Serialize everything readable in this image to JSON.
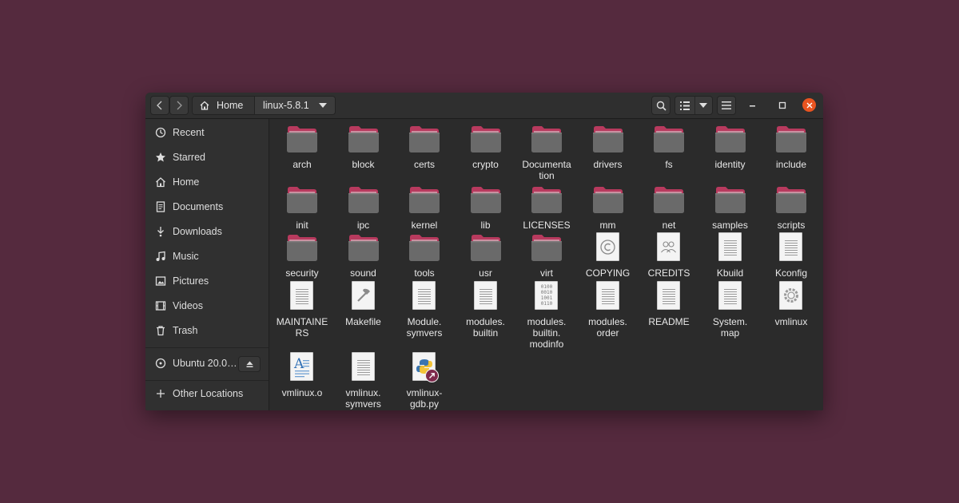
{
  "header": {
    "crumbs": [
      {
        "label": "Home",
        "icon": "home-icon"
      },
      {
        "label": "linux-5.8.1",
        "icon": "chevron-down-icon"
      }
    ]
  },
  "window_controls": [
    "minimize",
    "maximize",
    "close"
  ],
  "sidebar": {
    "items": [
      {
        "label": "Recent",
        "icon": "clock-icon"
      },
      {
        "label": "Starred",
        "icon": "star-icon"
      },
      {
        "label": "Home",
        "icon": "home-icon"
      },
      {
        "label": "Documents",
        "icon": "document-icon"
      },
      {
        "label": "Downloads",
        "icon": "download-icon"
      },
      {
        "label": "Music",
        "icon": "music-icon"
      },
      {
        "label": "Pictures",
        "icon": "pictures-icon"
      },
      {
        "label": "Videos",
        "icon": "video-icon"
      },
      {
        "label": "Trash",
        "icon": "trash-icon"
      }
    ],
    "devices": [
      {
        "label": "Ubuntu 20.0…",
        "icon": "disc-icon",
        "eject": "eject-icon"
      }
    ],
    "other": {
      "label": "Other Locations",
      "icon": "plus-icon"
    }
  },
  "files": [
    {
      "name": "arch",
      "type": "folder"
    },
    {
      "name": "block",
      "type": "folder"
    },
    {
      "name": "certs",
      "type": "folder"
    },
    {
      "name": "crypto",
      "type": "folder"
    },
    {
      "name": "Documenta\ntion",
      "type": "folder"
    },
    {
      "name": "drivers",
      "type": "folder"
    },
    {
      "name": "fs",
      "type": "folder"
    },
    {
      "name": "identity",
      "type": "folder"
    },
    {
      "name": "include",
      "type": "folder"
    },
    {
      "name": "init",
      "type": "folder"
    },
    {
      "name": "ipc",
      "type": "folder"
    },
    {
      "name": "kernel",
      "type": "folder"
    },
    {
      "name": "lib",
      "type": "folder"
    },
    {
      "name": "LICENSES",
      "type": "folder"
    },
    {
      "name": "mm",
      "type": "folder"
    },
    {
      "name": "net",
      "type": "folder"
    },
    {
      "name": "samples",
      "type": "folder"
    },
    {
      "name": "scripts",
      "type": "folder"
    },
    {
      "name": "security",
      "type": "folder"
    },
    {
      "name": "sound",
      "type": "folder"
    },
    {
      "name": "tools",
      "type": "folder"
    },
    {
      "name": "usr",
      "type": "folder"
    },
    {
      "name": "virt",
      "type": "folder"
    },
    {
      "name": "COPYING",
      "type": "copyright"
    },
    {
      "name": "CREDITS",
      "type": "people"
    },
    {
      "name": "Kbuild",
      "type": "text"
    },
    {
      "name": "Kconfig",
      "type": "text"
    },
    {
      "name": "MAINTAINE\nRS",
      "type": "text"
    },
    {
      "name": "Makefile",
      "type": "makefile"
    },
    {
      "name": "Module.\nsymvers",
      "type": "text"
    },
    {
      "name": "modules.\nbuiltin",
      "type": "text"
    },
    {
      "name": "modules.\nbuiltin.\nmodinfo",
      "type": "binary"
    },
    {
      "name": "modules.\norder",
      "type": "text"
    },
    {
      "name": "README",
      "type": "text"
    },
    {
      "name": "System.\nmap",
      "type": "text"
    },
    {
      "name": "vmlinux",
      "type": "executable"
    },
    {
      "name": "vmlinux.o",
      "type": "object"
    },
    {
      "name": "vmlinux.\nsymvers",
      "type": "text"
    },
    {
      "name": "vmlinux-\ngdb.py",
      "type": "python-link"
    }
  ],
  "colors": {
    "desktop": "#552a3e",
    "accent": "#e95420",
    "folder_tab": "#b83a5e",
    "folder_body": "#6a6a6a"
  }
}
